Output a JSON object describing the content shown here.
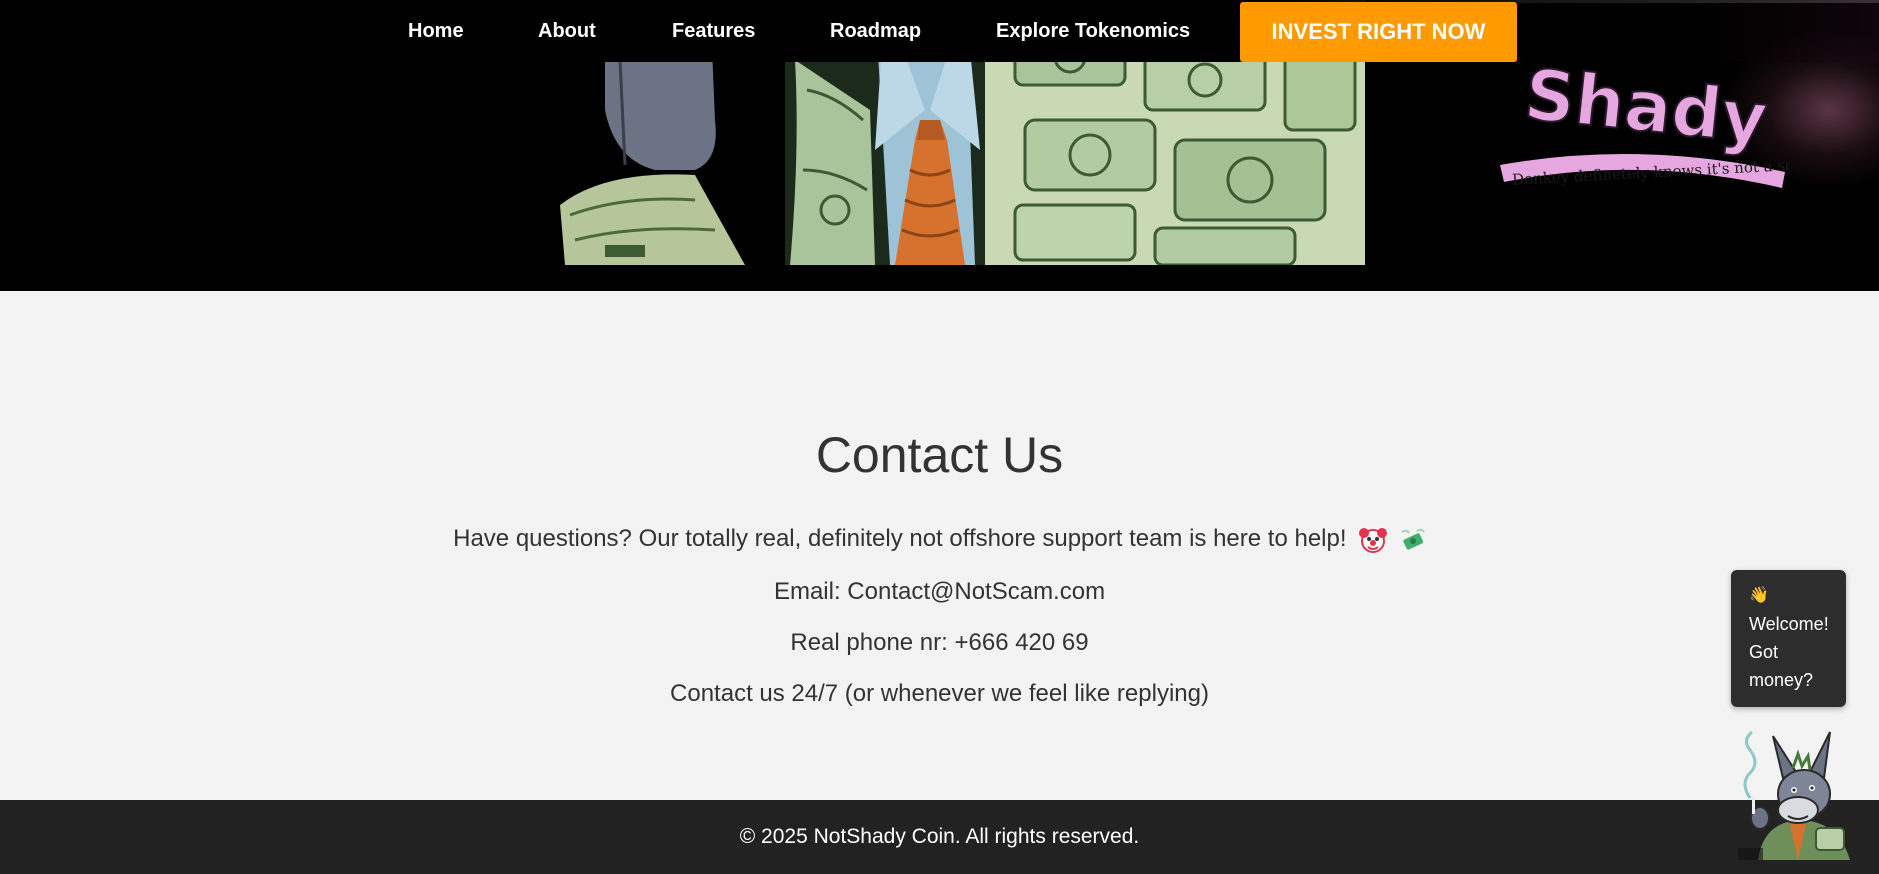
{
  "nav": {
    "items": [
      {
        "label": "Home"
      },
      {
        "label": "About"
      },
      {
        "label": "Features"
      },
      {
        "label": "Roadmap"
      },
      {
        "label": "Explore Tokenomics"
      }
    ],
    "cta_label": "INVEST RIGHT NOW",
    "cta_color": "#ff9a00"
  },
  "logo": {
    "wordmark": "Shady",
    "tagline": "Donkey definetely knows  it's not a scam."
  },
  "contact": {
    "title": "Contact Us",
    "intro": "Have questions? Our totally real, definitely not offshore support team is here to help!",
    "email": "Email: Contact@NotScam.com",
    "phone": "Real phone nr: +666 420 69",
    "hours": "Contact us 24/7 (or whenever we feel like replying)"
  },
  "footer": {
    "copyright": "© 2025 NotShady Coin. All rights reserved."
  },
  "chat": {
    "wave": "👋",
    "message": "Welcome! Got money?"
  },
  "colors": {
    "hero_bg": "#000000",
    "page_bg": "#f3f3f3",
    "footer_bg": "#222222",
    "text": "#333333",
    "chat_bg": "#2d2d2d",
    "logo_pink": "#e6a6e0"
  }
}
